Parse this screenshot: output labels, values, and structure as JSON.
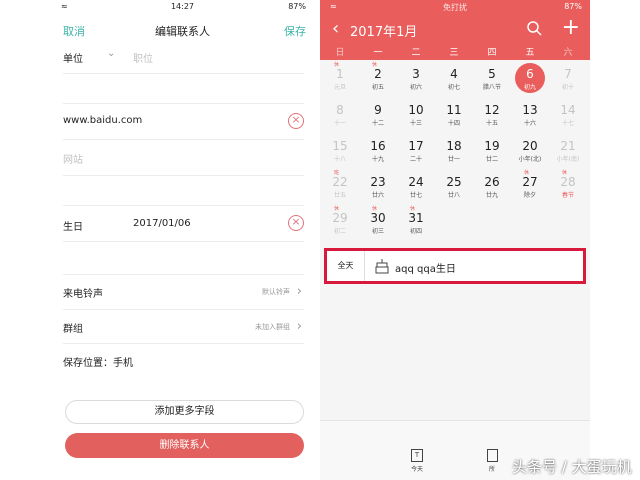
{
  "contact": {
    "status": {
      "time": "14:27",
      "battery": "87%"
    },
    "cancel": "取消",
    "title": "编辑联系人",
    "save": "保存",
    "company_label": "单位",
    "title_placeholder": "职位",
    "website_value": "www.baidu.com",
    "website_placeholder": "网站",
    "birthday_label": "生日",
    "birthday_value": "2017/01/06",
    "ringtone_label": "来电铃声",
    "ringtone_value": "默认铃声",
    "group_label": "群组",
    "group_value": "未加入群组",
    "storage": "保存位置：手机",
    "add_fields": "添加更多字段",
    "delete": "删除联系人"
  },
  "calendar": {
    "status": {
      "mode": "免打扰",
      "battery": "87%"
    },
    "month_title": "2017年1月",
    "weekdays": [
      "日",
      "一",
      "二",
      "三",
      "四",
      "五",
      "六"
    ],
    "weeks": [
      [
        {
          "n": "1",
          "s": "元旦",
          "dim": true,
          "tag": "休"
        },
        {
          "n": "2",
          "s": "初五",
          "tag": "休"
        },
        {
          "n": "3",
          "s": "初六"
        },
        {
          "n": "4",
          "s": "初七"
        },
        {
          "n": "5",
          "s": "腊八节"
        },
        {
          "n": "6",
          "s": "初九",
          "selected": true
        },
        {
          "n": "7",
          "s": "初十",
          "dim": true
        }
      ],
      [
        {
          "n": "8",
          "s": "十一",
          "dim": true
        },
        {
          "n": "9",
          "s": "十二"
        },
        {
          "n": "10",
          "s": "十三"
        },
        {
          "n": "11",
          "s": "十四"
        },
        {
          "n": "12",
          "s": "十五"
        },
        {
          "n": "13",
          "s": "十六"
        },
        {
          "n": "14",
          "s": "十七",
          "dim": true
        }
      ],
      [
        {
          "n": "15",
          "s": "十八",
          "dim": true
        },
        {
          "n": "16",
          "s": "十九"
        },
        {
          "n": "17",
          "s": "二十"
        },
        {
          "n": "18",
          "s": "廿一"
        },
        {
          "n": "19",
          "s": "廿二"
        },
        {
          "n": "20",
          "s": "小年(北)"
        },
        {
          "n": "21",
          "s": "小年(南)",
          "dim": true
        }
      ],
      [
        {
          "n": "22",
          "s": "廿五",
          "dim": true,
          "tag": "班"
        },
        {
          "n": "23",
          "s": "廿六"
        },
        {
          "n": "24",
          "s": "廿七"
        },
        {
          "n": "25",
          "s": "廿八"
        },
        {
          "n": "26",
          "s": "廿九"
        },
        {
          "n": "27",
          "s": "除夕",
          "tag": "休"
        },
        {
          "n": "28",
          "s": "春节",
          "dim": true,
          "fest": true,
          "tag": "休"
        }
      ],
      [
        {
          "n": "29",
          "s": "初二",
          "dim": true,
          "tag": "休"
        },
        {
          "n": "30",
          "s": "初三",
          "tag": "休"
        },
        {
          "n": "31",
          "s": "初四",
          "tag": "休"
        }
      ]
    ],
    "event": {
      "all_day": "全天",
      "name": "aqq qqa生日"
    },
    "bottom": {
      "today_label": "今天",
      "today_glyph": "T",
      "second_label": "所"
    }
  },
  "watermark": "头条号 / 大蛋玩机"
}
